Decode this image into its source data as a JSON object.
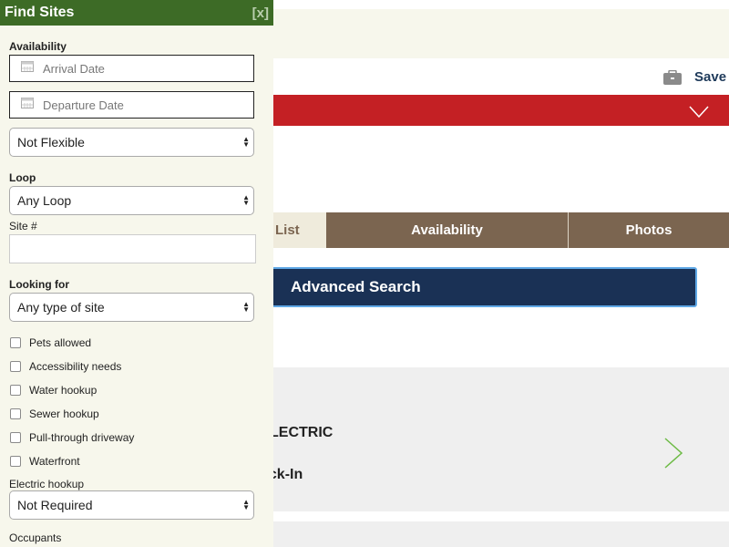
{
  "background": {
    "save_label": "Save",
    "tabs": [
      {
        "label": "List"
      },
      {
        "label": "Availability"
      },
      {
        "label": "Photos"
      }
    ],
    "advanced_search_label": "Advanced Search",
    "result": {
      "line1": "LECTRIC",
      "line2": "ack-In"
    }
  },
  "panel": {
    "title": "Find Sites",
    "close_label": "[x]",
    "availability_label": "Availability",
    "arrival_placeholder": "Arrival Date",
    "departure_placeholder": "Departure Date",
    "flexibility_value": "Not Flexible",
    "loop_label": "Loop",
    "loop_value": "Any Loop",
    "site_label": "Site #",
    "site_value": "",
    "looking_for_label": "Looking for",
    "looking_for_value": "Any type of site",
    "checkboxes": [
      {
        "label": "Pets allowed",
        "checked": false
      },
      {
        "label": "Accessibility needs",
        "checked": false
      },
      {
        "label": "Water hookup",
        "checked": false
      },
      {
        "label": "Sewer hookup",
        "checked": false
      },
      {
        "label": "Pull-through driveway",
        "checked": false
      },
      {
        "label": "Waterfront",
        "checked": false
      }
    ],
    "electric_label": "Electric hookup",
    "electric_value": "Not Required",
    "occupants_label": "Occupants"
  },
  "colors": {
    "panel_header": "#3d6b26",
    "panel_bg": "#f7f7ec",
    "red_bar": "#c42024",
    "tab_brown": "#7b6550",
    "advanced_search_bg": "#1a3155",
    "chevron_green": "#6dbb45"
  }
}
